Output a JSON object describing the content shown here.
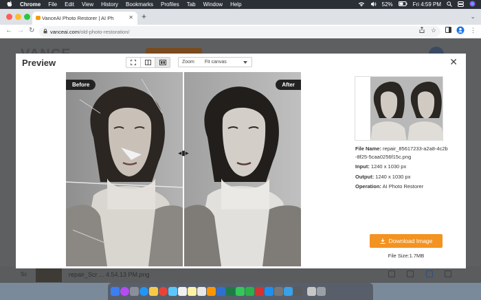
{
  "menubar": {
    "app_name": "Chrome",
    "items": [
      "File",
      "Edit",
      "View",
      "History",
      "Bookmarks",
      "Profiles",
      "Tab",
      "Window",
      "Help"
    ],
    "battery": "52%",
    "clock": "Fri 4:59 PM"
  },
  "browser": {
    "tab_title": "VanceAI Photo Restorer | AI Ph",
    "url_host": "vanceai.com",
    "url_path": "/old-photo-restoration/"
  },
  "background_page": {
    "logo": "VANCE",
    "download_filename": "repair_Scr ... 4.54.13 PM.png",
    "snippet": "Sc"
  },
  "modal": {
    "title": "Preview",
    "zoom_label": "Zoom",
    "zoom_value": "Fit canvas",
    "before_label": "Before",
    "after_label": "After",
    "file_name_label": "File Name:",
    "file_name_line1": "repair_85617233-a2a8-4c2b",
    "file_name_line2": "-8f25-5caa0256f15c.png",
    "input_label": "Input:",
    "input_value": "1240 x 1030 px",
    "output_label": "Output:",
    "output_value": "1240 x 1030 px",
    "operation_label": "Operation:",
    "operation_value": "AI Photo Restorer",
    "download_label": "Download Image",
    "file_size": "File Size:1.7MB"
  },
  "colors": {
    "accent": "#f39322",
    "menubar": "#2b2f36"
  }
}
